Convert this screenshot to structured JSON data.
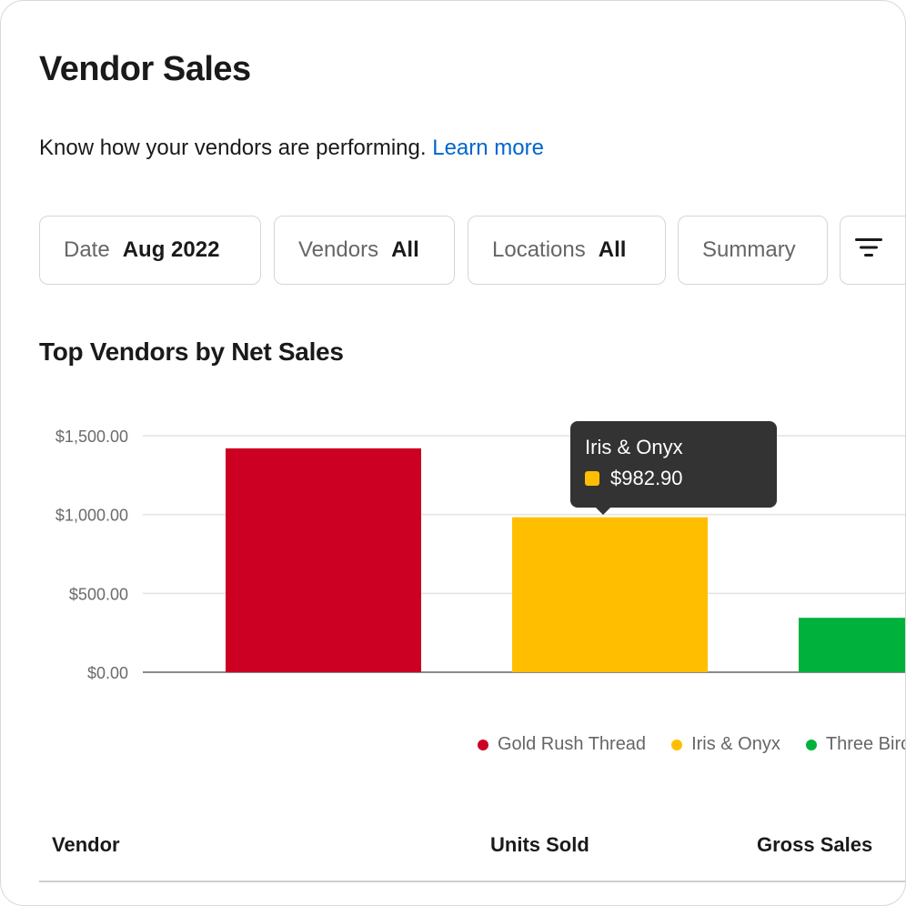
{
  "page": {
    "title": "Vendor Sales",
    "intro": "Know how your vendors are performing.",
    "learn_more": "Learn more"
  },
  "filters": {
    "date": {
      "label": "Date",
      "value": "Aug 2022"
    },
    "vendors": {
      "label": "Vendors",
      "value": "All"
    },
    "locations": {
      "label": "Locations",
      "value": "All"
    },
    "summary": {
      "label": "Summary"
    },
    "menu_icon": "filter-lines-icon"
  },
  "chart_data": {
    "type": "bar",
    "title": "Top Vendors by Net Sales",
    "categories": [
      "Gold Rush Thread",
      "Iris & Onyx",
      "Three Birc"
    ],
    "values": [
      1420,
      982.9,
      345
    ],
    "colors": [
      "#cc0023",
      "#ffbf00",
      "#00b23b"
    ],
    "ylim": [
      0,
      1500
    ],
    "yticks": [
      "$0.00",
      "$500.00",
      "$1,000.00",
      "$1,500.00"
    ],
    "grid": true,
    "legend_position": "bottom"
  },
  "tooltip": {
    "name": "Iris & Onyx",
    "value": "$982.90",
    "color": "#ffbf00"
  },
  "table": {
    "columns": [
      "Vendor",
      "Units Sold",
      "Gross Sales"
    ]
  }
}
